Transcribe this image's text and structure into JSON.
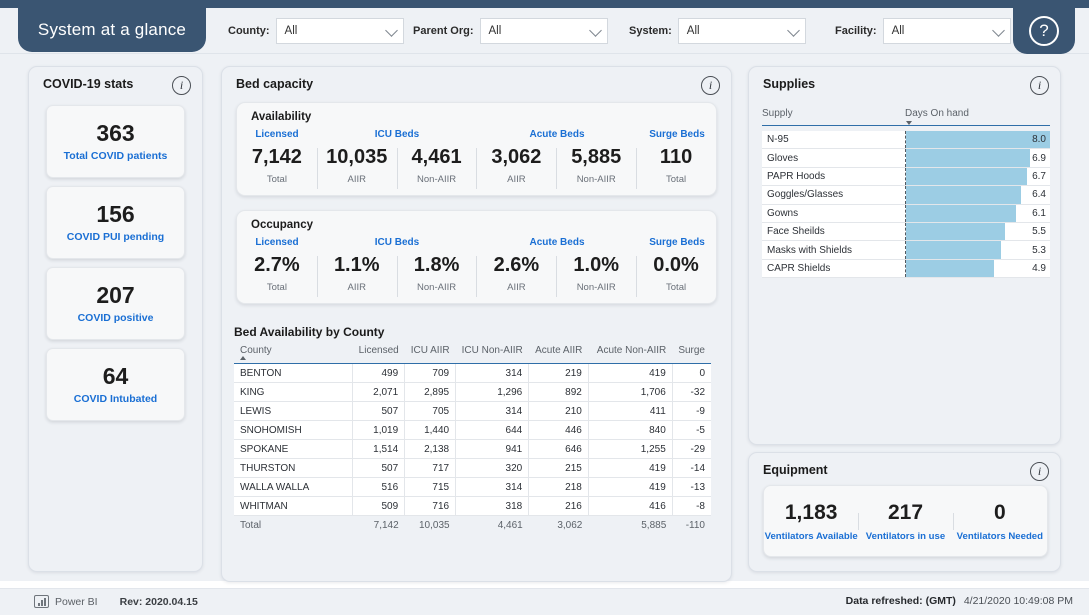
{
  "header": {
    "title": "System at a glance",
    "help_icon": "question-mark-icon",
    "filters": [
      {
        "label": "County:",
        "value": "All"
      },
      {
        "label": "Parent Org:",
        "value": "All"
      },
      {
        "label": "System:",
        "value": "All"
      },
      {
        "label": "Facility:",
        "value": "All"
      }
    ]
  },
  "covid": {
    "title": "COVID-19 stats",
    "tiles": [
      {
        "value": "363",
        "label": "Total COVID patients"
      },
      {
        "value": "156",
        "label": "COVID PUI pending"
      },
      {
        "value": "207",
        "label": "COVID positive"
      },
      {
        "value": "64",
        "label": "COVID Intubated"
      }
    ]
  },
  "bed_capacity": {
    "title": "Bed capacity",
    "availability": {
      "title": "Availability",
      "groups": [
        {
          "name": "Licensed",
          "span": 1
        },
        {
          "name": "ICU Beds",
          "span": 2
        },
        {
          "name": "Acute Beds",
          "span": 2
        },
        {
          "name": "Surge Beds",
          "span": 1
        }
      ],
      "cells": [
        {
          "value": "7,142",
          "sub": "Total"
        },
        {
          "value": "10,035",
          "sub": "AIIR"
        },
        {
          "value": "4,461",
          "sub": "Non-AIIR"
        },
        {
          "value": "3,062",
          "sub": "AIIR"
        },
        {
          "value": "5,885",
          "sub": "Non-AIIR"
        },
        {
          "value": "110",
          "sub": "Total"
        }
      ]
    },
    "occupancy": {
      "title": "Occupancy",
      "groups": [
        {
          "name": "Licensed",
          "span": 1
        },
        {
          "name": "ICU Beds",
          "span": 2
        },
        {
          "name": "Acute Beds",
          "span": 2
        },
        {
          "name": "Surge Beds",
          "span": 1
        }
      ],
      "cells": [
        {
          "value": "2.7%",
          "sub": "Total"
        },
        {
          "value": "1.1%",
          "sub": "AIIR"
        },
        {
          "value": "1.8%",
          "sub": "Non-AIIR"
        },
        {
          "value": "2.6%",
          "sub": "AIIR"
        },
        {
          "value": "1.0%",
          "sub": "Non-AIIR"
        },
        {
          "value": "0.0%",
          "sub": "Total"
        }
      ]
    },
    "table": {
      "title": "Bed Availability by County",
      "columns": [
        "County",
        "Licensed",
        "ICU AIIR",
        "ICU Non-AIIR",
        "Acute AIIR",
        "Acute Non-AIIR",
        "Surge"
      ],
      "sort_column": "County",
      "sort_direction": "ascending",
      "rows": [
        [
          "BENTON",
          "499",
          "709",
          "314",
          "219",
          "419",
          "0"
        ],
        [
          "KING",
          "2,071",
          "2,895",
          "1,296",
          "892",
          "1,706",
          "-32"
        ],
        [
          "LEWIS",
          "507",
          "705",
          "314",
          "210",
          "411",
          "-9"
        ],
        [
          "SNOHOMISH",
          "1,019",
          "1,440",
          "644",
          "446",
          "840",
          "-5"
        ],
        [
          "SPOKANE",
          "1,514",
          "2,138",
          "941",
          "646",
          "1,255",
          "-29"
        ],
        [
          "THURSTON",
          "507",
          "717",
          "320",
          "215",
          "419",
          "-14"
        ],
        [
          "WALLA WALLA",
          "516",
          "715",
          "314",
          "218",
          "419",
          "-13"
        ],
        [
          "WHITMAN",
          "509",
          "716",
          "318",
          "216",
          "416",
          "-8"
        ]
      ],
      "total_row": [
        "Total",
        "7,142",
        "10,035",
        "4,461",
        "3,062",
        "5,885",
        "-110"
      ]
    }
  },
  "supplies": {
    "title": "Supplies",
    "columns": [
      "Supply",
      "Days On hand"
    ],
    "sort_column": "Days On hand",
    "sort_direction": "descending",
    "bar_color": "#9ccde4",
    "chart_data": {
      "type": "bar",
      "title": "Supplies",
      "xlabel": "Days On hand",
      "ylabel": "Supply",
      "categories": [
        "N-95",
        "Gloves",
        "PAPR Hoods",
        "Goggles/Glasses",
        "Gowns",
        "Face Sheilds",
        "Masks with Shields",
        "CAPR Shields"
      ],
      "values": [
        8.0,
        6.9,
        6.7,
        6.4,
        6.1,
        5.5,
        5.3,
        4.9
      ],
      "xlim": [
        0,
        8.0
      ],
      "grid": false,
      "legend": "none"
    }
  },
  "equipment": {
    "title": "Equipment",
    "cells": [
      {
        "value": "1,183",
        "label": "Ventilators Available"
      },
      {
        "value": "217",
        "label": "Ventilators in use"
      },
      {
        "value": "0",
        "label": "Ventilators Needed"
      }
    ]
  },
  "footer": {
    "brand": "Power BI",
    "rev": "Rev: 2020.04.15",
    "refresh_label": "Data refreshed: (GMT)",
    "refresh_time": "4/21/2020 10:49:08 PM"
  }
}
